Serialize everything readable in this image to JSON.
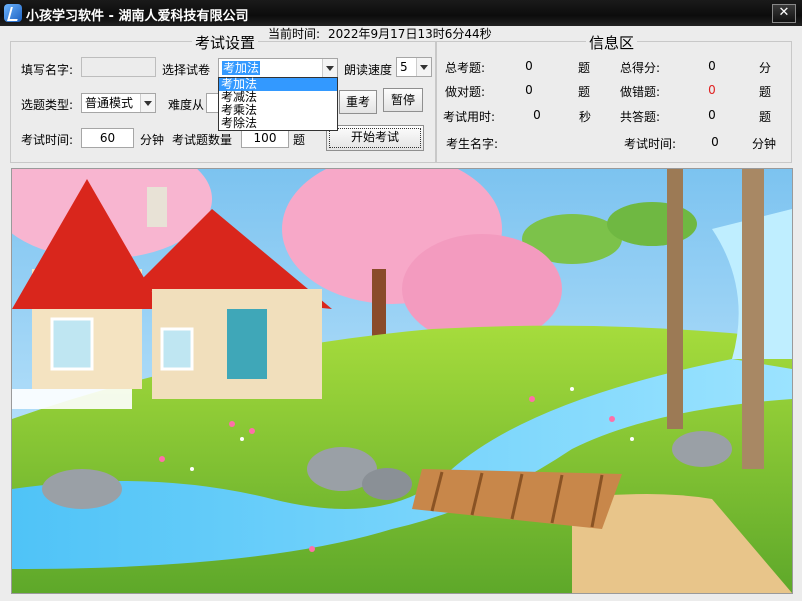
{
  "window": {
    "title": "小孩学习软件 - 湖南人爱科技有限公司",
    "close_glyph": "✕",
    "current_time_label": "当前时间:",
    "current_time": "2022年9月17日13时6分44秒"
  },
  "settings": {
    "group_title": "考试设置",
    "name_label": "填写名字:",
    "name_value": "",
    "exam_select_label": "选择试卷",
    "exam_selected": "考加法",
    "exam_options": [
      "考加法",
      "考减法",
      "考乘法",
      "考除法"
    ],
    "read_speed_label": "朗读速度",
    "read_speed_value": "5",
    "question_type_label": "选题类型:",
    "question_type_value": "普通模式",
    "difficulty_label": "难度从",
    "retake_button": "重考",
    "pause_button": "暂停",
    "exam_time_label": "考试时间:",
    "exam_time_value": "60",
    "exam_time_unit": "分钟",
    "question_count_label": "考试题数量",
    "question_count_value": "100",
    "question_count_unit": "题",
    "start_button": "开始考试"
  },
  "info": {
    "group_title": "信息区",
    "total_questions_label": "总考题:",
    "total_questions_value": "0",
    "total_questions_unit": "题",
    "total_score_label": "总得分:",
    "total_score_value": "0",
    "total_score_unit": "分",
    "correct_label": "做对题:",
    "correct_value": "0",
    "correct_unit": "题",
    "wrong_label": "做错题:",
    "wrong_value": "0",
    "wrong_unit": "题",
    "time_used_label": "考试用时:",
    "time_used_value": "0",
    "time_used_unit": "秒",
    "answered_label": "共答题:",
    "answered_value": "0",
    "answered_unit": "题",
    "student_name_label": "考生名字:",
    "student_name_value": "",
    "exam_time_label": "考试时间:",
    "exam_time_value": "0",
    "exam_time_unit": "分钟"
  },
  "colors": {
    "highlight": "#3399ff",
    "wrong_value": "#e02020"
  }
}
